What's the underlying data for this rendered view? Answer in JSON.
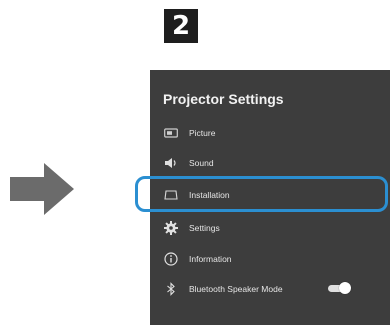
{
  "step": {
    "number": "2"
  },
  "panel": {
    "title": "Projector Settings",
    "items": [
      {
        "label": "Picture",
        "icon": "picture-icon"
      },
      {
        "label": "Sound",
        "icon": "speaker-icon"
      },
      {
        "label": "Installation",
        "icon": "installation-icon"
      },
      {
        "label": "Settings",
        "icon": "gear-icon"
      },
      {
        "label": "Information",
        "icon": "info-icon"
      },
      {
        "label": "Bluetooth Speaker Mode",
        "icon": "bluetooth-icon",
        "toggle": "on"
      }
    ]
  },
  "colors": {
    "panel_bg": "#3d3d3d",
    "highlight": "#2b8fd1",
    "arrow": "#6b6b6b",
    "badge_bg": "#1e1e1e"
  },
  "selection": {
    "highlighted_item": "Installation"
  }
}
